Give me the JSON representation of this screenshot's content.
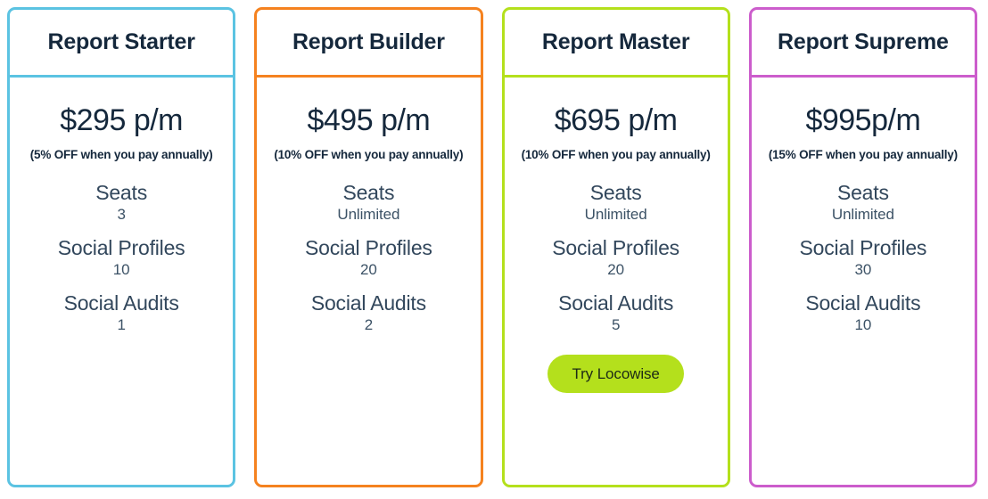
{
  "accent_colors": {
    "blue": "#5bc3e2",
    "orange": "#f5821f",
    "lime": "#b4e01c",
    "magenta": "#cc5dcc"
  },
  "text_colors": {
    "title": "#15283c",
    "price": "#15283c",
    "feature_label": "#32475c",
    "feature_value": "#3c5266",
    "cta_text": "#1d2a16"
  },
  "plans": [
    {
      "title": "Report Starter",
      "price": "$295 p/m",
      "discount": "(5% OFF when you pay annually)",
      "features": [
        {
          "label": "Seats",
          "value": "3"
        },
        {
          "label": "Social Profiles",
          "value": "10"
        },
        {
          "label": "Social Audits",
          "value": "1"
        }
      ],
      "cta": null
    },
    {
      "title": "Report Builder",
      "price": "$495 p/m",
      "discount": "(10% OFF when you pay annually)",
      "features": [
        {
          "label": "Seats",
          "value": "Unlimited"
        },
        {
          "label": "Social Profiles",
          "value": "20"
        },
        {
          "label": "Social Audits",
          "value": "2"
        }
      ],
      "cta": null
    },
    {
      "title": "Report Master",
      "price": "$695 p/m",
      "discount": "(10% OFF when you pay annually)",
      "features": [
        {
          "label": "Seats",
          "value": "Unlimited"
        },
        {
          "label": "Social Profiles",
          "value": "20"
        },
        {
          "label": "Social Audits",
          "value": "5"
        }
      ],
      "cta": "Try Locowise"
    },
    {
      "title": "Report Supreme",
      "price": "$995p/m",
      "discount": "(15% OFF when you pay annually)",
      "features": [
        {
          "label": "Seats",
          "value": "Unlimited"
        },
        {
          "label": "Social Profiles",
          "value": "30"
        },
        {
          "label": "Social Audits",
          "value": "10"
        }
      ],
      "cta": null
    }
  ]
}
